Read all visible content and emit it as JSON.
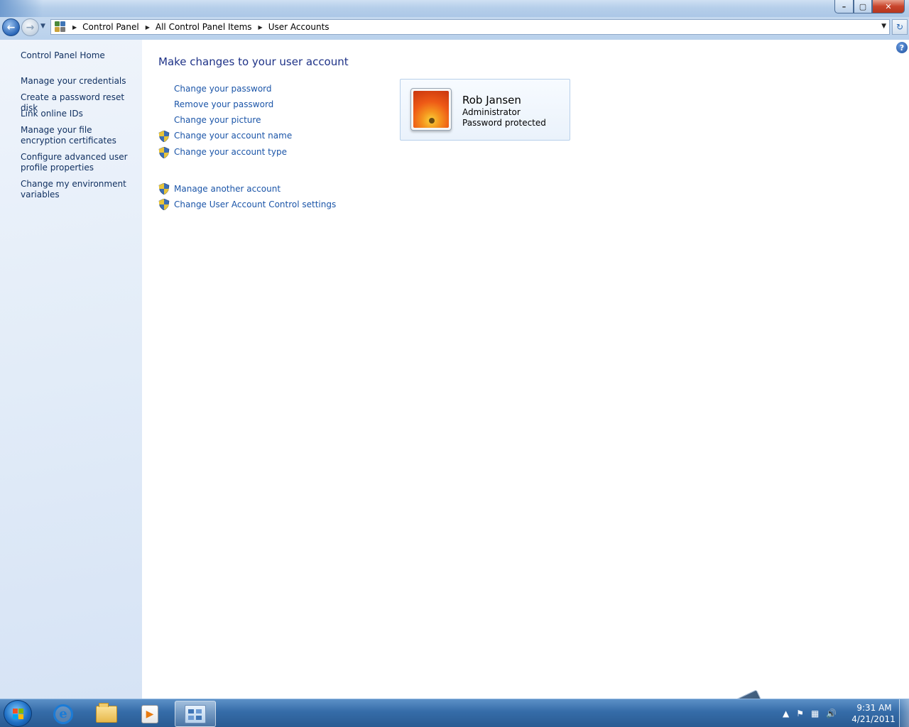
{
  "window": {
    "minimize": "–",
    "maximize": "▢",
    "close": "✕"
  },
  "nav": {
    "back": "←",
    "forward": "→",
    "history_dropdown": "▼"
  },
  "address": {
    "crumbs": [
      "Control Panel",
      "All Control Panel Items",
      "User Accounts"
    ],
    "separator": "▶",
    "dropdown": "▼",
    "refresh": "↻"
  },
  "sidebar": {
    "items": [
      {
        "label": "Control Panel Home"
      },
      {
        "label": "Manage your credentials"
      },
      {
        "label": "Create a password reset disk"
      },
      {
        "label": "Link online IDs"
      },
      {
        "label": "Manage your file encryption certificates"
      },
      {
        "label": "Configure advanced user profile properties"
      },
      {
        "label": "Change my environment variables"
      }
    ]
  },
  "main": {
    "title": "Make changes to your user account",
    "help": "?",
    "tasks": [
      {
        "label": "Change your password",
        "shield": false
      },
      {
        "label": "Remove your password",
        "shield": false
      },
      {
        "label": "Change your picture",
        "shield": false
      },
      {
        "label": "Change your account name",
        "shield": true
      },
      {
        "label": "Change your account type",
        "shield": true
      }
    ],
    "other_tasks": [
      {
        "label": "Manage another account",
        "shield": true
      },
      {
        "label": "Change User Account Control settings",
        "shield": true
      }
    ]
  },
  "user": {
    "name": "Rob Jansen",
    "role": "Administrator",
    "status": "Password protected"
  },
  "taskbar": {
    "clock_time": "9:31 AM",
    "clock_date": "4/21/2011",
    "tray_icons": [
      "show-hidden-icon",
      "action-center-flag-icon",
      "network-icon",
      "volume-icon"
    ],
    "tray_glyphs": [
      "▲",
      "⚑",
      "▦",
      "🔊"
    ],
    "pinned": [
      "internet-explorer",
      "windows-explorer",
      "windows-media-player",
      "control-panel"
    ],
    "ie_glyph": "e",
    "media_glyph": "▶"
  },
  "colors": {
    "link": "#1b55a8",
    "title": "#1e3287",
    "sidebar_link": "#0e2e5f",
    "taskbar": "#356ca8"
  }
}
